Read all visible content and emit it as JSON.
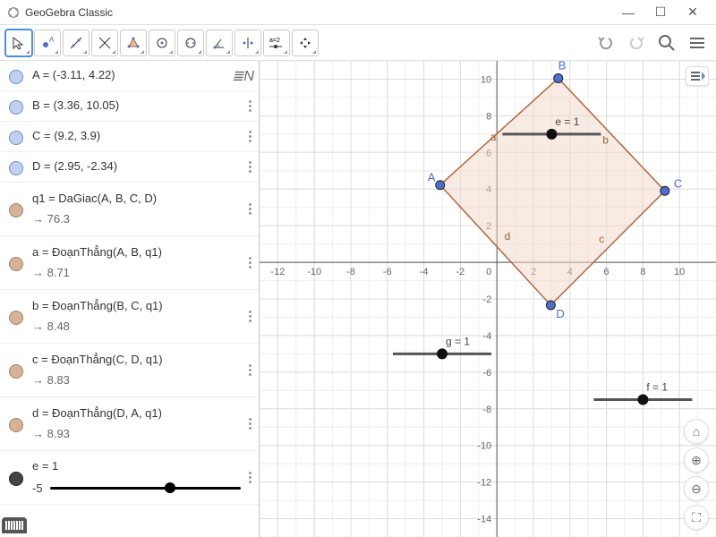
{
  "window": {
    "title": "GeoGebra Classic"
  },
  "window_controls": {
    "min": "—",
    "max": "☐",
    "close": "✕"
  },
  "toolbar_right": {
    "undo": "↶",
    "redo": "↷",
    "search": "🔍",
    "menu": "≡"
  },
  "algebra": {
    "items": [
      {
        "dot": "blue",
        "def": "A = (-3.11, 4.22)",
        "sub": "",
        "tall": false,
        "toggle": true
      },
      {
        "dot": "blue",
        "def": "B = (3.36, 10.05)",
        "sub": "",
        "tall": false
      },
      {
        "dot": "blue",
        "def": "C = (9.2, 3.9)",
        "sub": "",
        "tall": false
      },
      {
        "dot": "blue",
        "def": "D = (2.95, -2.34)",
        "sub": "",
        "tall": false
      },
      {
        "dot": "brown",
        "def": "q1 = DaGiac(A, B, C, D)",
        "sub": "→  76.3",
        "tall": true
      },
      {
        "dot": "brown",
        "def": "a = ĐoạnThẳng(A, B, q1)",
        "sub": "→  8.71",
        "tall": true
      },
      {
        "dot": "brown",
        "def": "b = ĐoạnThẳng(B, C, q1)",
        "sub": "→  8.48",
        "tall": true
      },
      {
        "dot": "brown",
        "def": "c = ĐoạnThẳng(C, D, q1)",
        "sub": "→  8.83",
        "tall": true
      },
      {
        "dot": "brown",
        "def": "d = ĐoạnThẳng(D, A, q1)",
        "sub": "→  8.93",
        "tall": true
      },
      {
        "dot": "black",
        "def": "e = 1",
        "sub": "",
        "tall": true,
        "slider": {
          "min": "-5",
          "pos": 60
        }
      }
    ]
  },
  "chart_data": {
    "type": "scatter",
    "xlim": [
      -13,
      12
    ],
    "ylim": [
      -15,
      11
    ],
    "xticks": [
      -12,
      -10,
      -8,
      -6,
      -4,
      -2,
      0,
      2,
      4,
      6,
      8,
      10
    ],
    "yticks": [
      -14,
      -12,
      -10,
      -8,
      -6,
      -4,
      -2,
      0,
      2,
      4,
      6,
      8,
      10
    ],
    "points": [
      {
        "name": "A",
        "x": -3.11,
        "y": 4.22
      },
      {
        "name": "B",
        "x": 3.36,
        "y": 10.05
      },
      {
        "name": "C",
        "x": 9.2,
        "y": 3.9
      },
      {
        "name": "D",
        "x": 2.95,
        "y": -2.34
      }
    ],
    "polygon": [
      "A",
      "B",
      "C",
      "D"
    ],
    "edge_labels": {
      "a": "AB",
      "b": "BC",
      "c": "CD",
      "d": "DA"
    },
    "sliders": [
      {
        "name": "e",
        "value": 1,
        "x": 3,
        "y": 7
      },
      {
        "name": "g",
        "value": 1,
        "x": -3,
        "y": -5
      },
      {
        "name": "f",
        "value": 1,
        "x": 8,
        "y": -7.5
      }
    ]
  },
  "side_tools": {
    "home": "⌂",
    "zoom_in": "⊕",
    "zoom_out": "⊖",
    "fullscreen": "⛶",
    "styles": "≡◣"
  }
}
